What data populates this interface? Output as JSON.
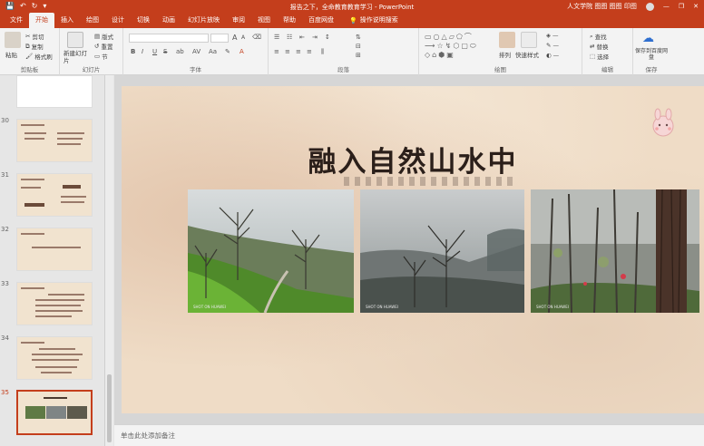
{
  "window": {
    "title": "报告之下，全命教育教育学习 - PowerPoint",
    "user": "人文学院 图图 图图 印图",
    "controls": [
      "—",
      "❐",
      "✕"
    ]
  },
  "qat": [
    "💾",
    "↶",
    "↻",
    "▾"
  ],
  "tabs": [
    "文件",
    "开始",
    "插入",
    "绘图",
    "设计",
    "切换",
    "动画",
    "幻灯片放映",
    "审阅",
    "视图",
    "帮助",
    "百度网盘"
  ],
  "active_tab": "开始",
  "tell_me": "操作说明搜索",
  "ribbon": {
    "clipboard": {
      "label": "剪贴板",
      "paste": "粘贴",
      "cut": "剪切",
      "copy": "复制",
      "format_painter": "格式刷"
    },
    "slides": {
      "label": "幻灯片",
      "new_slide": "新建幻灯片",
      "layout": "版式",
      "reset": "重置",
      "section": "节"
    },
    "font": {
      "label": "字体",
      "bold": "B",
      "italic": "I",
      "underline": "U",
      "strike": "S",
      "size_up": "A",
      "size_down": "A"
    },
    "paragraph": {
      "label": "段落"
    },
    "drawing": {
      "label": "绘图",
      "arrange": "排列",
      "quick_styles": "快速样式"
    },
    "editing": {
      "label": "编辑",
      "find": "查找",
      "replace": "替换",
      "select": "选择"
    },
    "save": {
      "label": "保存",
      "save_to_cloud": "保存到百度网盘"
    }
  },
  "thumbnails": [
    {
      "num": "",
      "active": false
    },
    {
      "num": "30",
      "active": false
    },
    {
      "num": "31",
      "active": false
    },
    {
      "num": "32",
      "active": false
    },
    {
      "num": "33",
      "active": false
    },
    {
      "num": "34",
      "active": false
    },
    {
      "num": "35",
      "active": true
    }
  ],
  "slide": {
    "title": "融入自然山水中",
    "photos": [
      {
        "caption": "SHOT ON HUAWEI"
      },
      {
        "caption": "SHOT ON HUAWEI"
      },
      {
        "caption": "SHOT ON HUAWEI"
      }
    ]
  },
  "notes": {
    "placeholder": "单击此处添加备注"
  },
  "colors": {
    "accent": "#c43e1c",
    "slide_bg": "#efdcc6",
    "title": "#2b1f1a"
  }
}
